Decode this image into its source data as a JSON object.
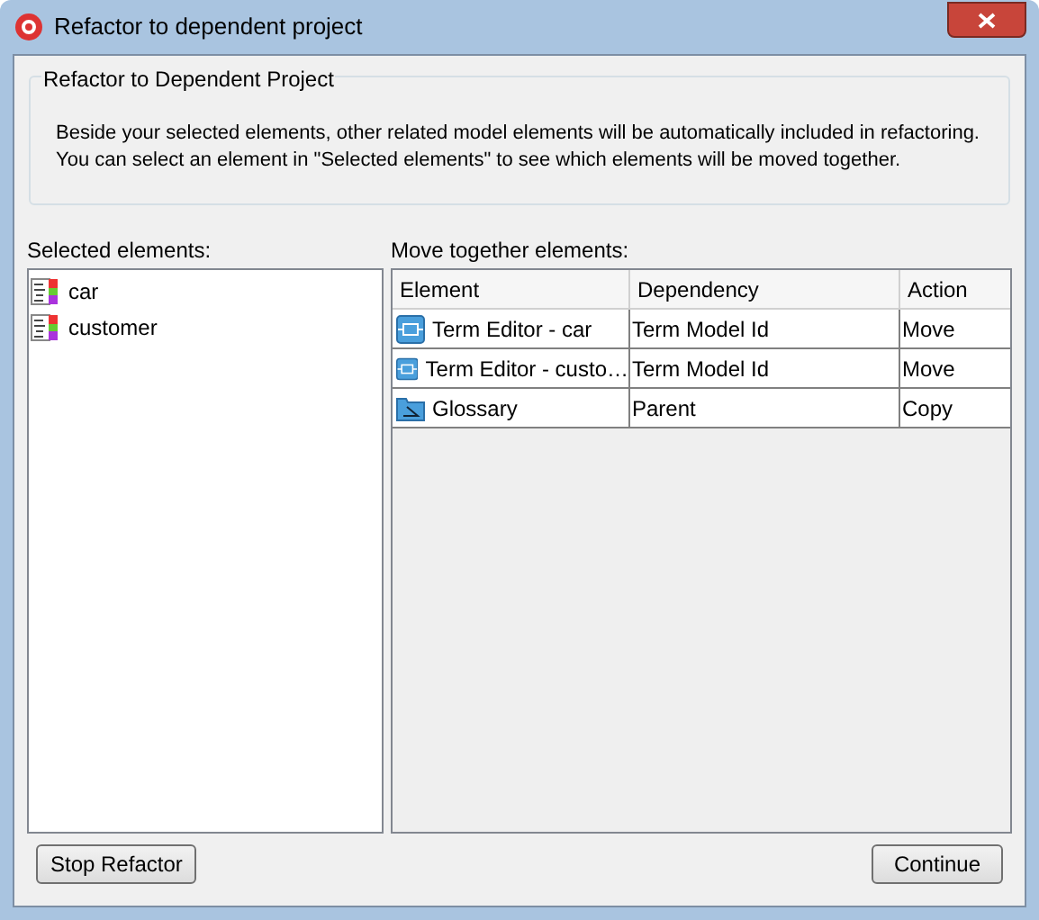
{
  "window": {
    "title": "Refactor to dependent project"
  },
  "group": {
    "title": "Refactor to Dependent Project",
    "lines": [
      "Beside your selected elements, other related model elements will be automatically included in refactoring.",
      "You can select an element in \"Selected elements\" to see which elements will be moved together."
    ]
  },
  "selected_elements": {
    "label": "Selected elements:",
    "items": [
      "car",
      "customer"
    ]
  },
  "move_together": {
    "label": "Move together elements:",
    "columns": [
      "Element",
      "Dependency",
      "Action"
    ],
    "rows": [
      {
        "kind": "editor",
        "cells": [
          "Term Editor - car",
          "Term Model Id",
          "Move"
        ]
      },
      {
        "kind": "editor",
        "cells": [
          "Term Editor - custo…",
          "Term Model Id",
          "Move"
        ]
      },
      {
        "kind": "glossary",
        "cells": [
          "Glossary",
          "Parent",
          "Copy"
        ]
      }
    ]
  },
  "buttons": {
    "left": "Stop Refactor",
    "right": "Continue"
  }
}
